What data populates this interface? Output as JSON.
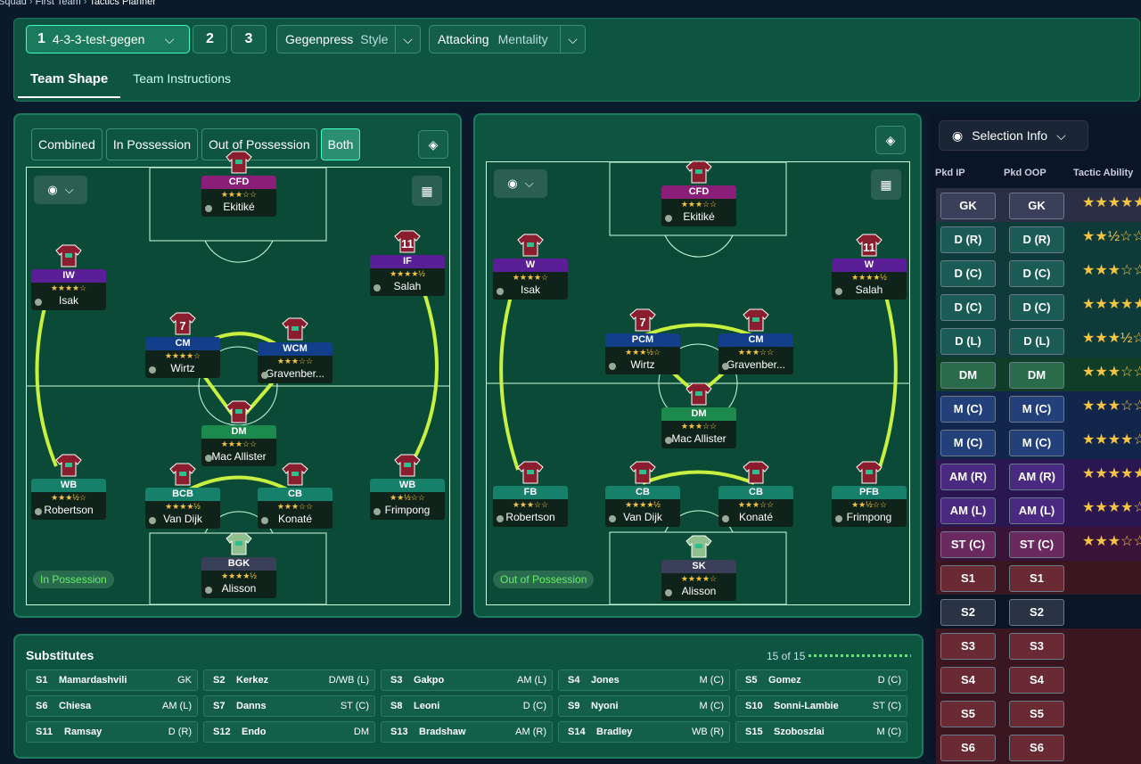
{
  "breadcrumb": {
    "a": "Squad",
    "b": "First Team",
    "c": "Tactics Planner"
  },
  "tactic": {
    "slot": "1",
    "name": "4-3-3-test-gegen",
    "slot2": "2",
    "slot3": "3",
    "style_value": "Gegenpress",
    "style_label": "Style",
    "mentality_value": "Attacking",
    "mentality_label": "Mentality"
  },
  "tabs": [
    "Team Shape",
    "Team Instructions"
  ],
  "phase_buttons": [
    "Combined",
    "In Possession",
    "Out of Possession",
    "Both"
  ],
  "in_possession_label": "In Possession",
  "out_possession_label": "Out of Possession",
  "ip_players": [
    {
      "role": "CFD",
      "name": "Ekitiké",
      "stars": "★★★☆☆",
      "color": "#8a1e78"
    },
    {
      "role": "IW",
      "name": "Isak",
      "stars": "★★★★☆",
      "color": "#5a1f96"
    },
    {
      "role": "IF",
      "name": "Salah",
      "stars": "★★★★½",
      "color": "#5a1f96",
      "num": "11"
    },
    {
      "role": "CM",
      "name": "Wirtz",
      "stars": "★★★★☆",
      "color": "#133f8a",
      "num": "7"
    },
    {
      "role": "WCM",
      "name": "Gravenber...",
      "stars": "★★★☆☆",
      "color": "#133f8a"
    },
    {
      "role": "DM",
      "name": "Mac Allister",
      "stars": "★★★☆☆",
      "color": "#1d8a4d"
    },
    {
      "role": "WB",
      "name": "Robertson",
      "stars": "★★★½☆",
      "color": "#17806a"
    },
    {
      "role": "BCB",
      "name": "Van Dijk",
      "stars": "★★★★½",
      "color": "#17806a"
    },
    {
      "role": "CB",
      "name": "Konaté",
      "stars": "★★★☆☆",
      "color": "#17806a"
    },
    {
      "role": "WB",
      "name": "Frimpong",
      "stars": "★★½☆☆",
      "color": "#17806a"
    },
    {
      "role": "BGK",
      "name": "Alisson",
      "stars": "★★★★½",
      "color": "#3a3f5a"
    }
  ],
  "op_players": [
    {
      "role": "CFD",
      "name": "Ekitiké",
      "stars": "★★★☆☆",
      "color": "#8a1e78"
    },
    {
      "role": "W",
      "name": "Isak",
      "stars": "★★★★☆",
      "color": "#5a1f96"
    },
    {
      "role": "W",
      "name": "Salah",
      "stars": "★★★★½",
      "color": "#5a1f96",
      "num": "11"
    },
    {
      "role": "PCM",
      "name": "Wirtz",
      "stars": "★★★½☆",
      "color": "#133f8a",
      "num": "7"
    },
    {
      "role": "CM",
      "name": "Gravenber...",
      "stars": "★★★☆☆",
      "color": "#133f8a"
    },
    {
      "role": "DM",
      "name": "Mac Allister",
      "stars": "★★★☆☆",
      "color": "#1d8a4d"
    },
    {
      "role": "FB",
      "name": "Robertson",
      "stars": "★★★☆☆",
      "color": "#17806a"
    },
    {
      "role": "CB",
      "name": "Van Dijk",
      "stars": "★★★★½",
      "color": "#17806a"
    },
    {
      "role": "CB",
      "name": "Konaté",
      "stars": "★★★☆☆",
      "color": "#17806a"
    },
    {
      "role": "PFB",
      "name": "Frimpong",
      "stars": "★★½☆☆",
      "color": "#17806a"
    },
    {
      "role": "SK",
      "name": "Alisson",
      "stars": "★★★★☆",
      "color": "#3a3f5a"
    }
  ],
  "substitutes": {
    "title": "Substitutes",
    "count": "15 of 15",
    "items": [
      {
        "n": "S1",
        "name": "Mamardashvili",
        "pos": "GK"
      },
      {
        "n": "S2",
        "name": "Kerkez",
        "pos": "D/WB (L)"
      },
      {
        "n": "S3",
        "name": "Gakpo",
        "pos": "AM (L)"
      },
      {
        "n": "S4",
        "name": "Jones",
        "pos": "M (C)"
      },
      {
        "n": "S5",
        "name": "Gomez",
        "pos": "D (C)"
      },
      {
        "n": "S6",
        "name": "Chiesa",
        "pos": "AM (L)"
      },
      {
        "n": "S7",
        "name": "Danns",
        "pos": "ST (C)"
      },
      {
        "n": "S8",
        "name": "Leoni",
        "pos": "D (C)"
      },
      {
        "n": "S9",
        "name": "Nyoni",
        "pos": "M (C)"
      },
      {
        "n": "S10",
        "name": "Sonni-Lambie",
        "pos": "ST (C)"
      },
      {
        "n": "S11",
        "name": "Ramsay",
        "pos": "D (R)"
      },
      {
        "n": "S12",
        "name": "Endo",
        "pos": "DM"
      },
      {
        "n": "S13",
        "name": "Bradshaw",
        "pos": "AM (R)"
      },
      {
        "n": "S14",
        "name": "Bradley",
        "pos": "WB (R)"
      },
      {
        "n": "S15",
        "name": "Szoboszlai",
        "pos": "M (C)"
      }
    ]
  },
  "selection": {
    "label": "Selection Info",
    "col1": "Pkd IP",
    "col2": "Pkd OOP",
    "col3": "Tactic Ability",
    "rows": [
      {
        "ip": "GK",
        "oop": "GK",
        "stars": "★★★★★",
        "bg": "#2a2f45",
        "tint": "#3a3f5a"
      },
      {
        "ip": "D (R)",
        "oop": "D (R)",
        "stars": "★★½☆☆",
        "bg": "#0e3b3a",
        "tint": "#1a5c55"
      },
      {
        "ip": "D (C)",
        "oop": "D (C)",
        "stars": "★★★☆☆",
        "bg": "#0e3b3a",
        "tint": "#1a5c55"
      },
      {
        "ip": "D (C)",
        "oop": "D (C)",
        "stars": "★★★★★",
        "bg": "#0e3b3a",
        "tint": "#1a5c55"
      },
      {
        "ip": "D (L)",
        "oop": "D (L)",
        "stars": "★★★½☆",
        "bg": "#0e3b3a",
        "tint": "#1a5c55"
      },
      {
        "ip": "DM",
        "oop": "DM",
        "stars": "★★★☆☆",
        "bg": "#0f3d28",
        "tint": "#2a6b4a"
      },
      {
        "ip": "M (C)",
        "oop": "M (C)",
        "stars": "★★★☆☆",
        "bg": "#12254a",
        "tint": "#23407a"
      },
      {
        "ip": "M (C)",
        "oop": "M (C)",
        "stars": "★★★★☆",
        "bg": "#12254a",
        "tint": "#23407a"
      },
      {
        "ip": "AM (R)",
        "oop": "AM (R)",
        "stars": "★★★★★",
        "bg": "#2a1650",
        "tint": "#4a2a80"
      },
      {
        "ip": "AM (L)",
        "oop": "AM (L)",
        "stars": "★★★★☆",
        "bg": "#2a1650",
        "tint": "#4a2a80"
      },
      {
        "ip": "ST (C)",
        "oop": "ST (C)",
        "stars": "★★★☆☆",
        "bg": "#3a1438",
        "tint": "#6a2a60"
      },
      {
        "ip": "S1",
        "oop": "S1",
        "stars": "",
        "bg": "#3a1620",
        "tint": "#6a2a34"
      },
      {
        "ip": "S2",
        "oop": "S2",
        "stars": "",
        "bg": "#0a1626",
        "tint": "#2a3344"
      },
      {
        "ip": "S3",
        "oop": "S3",
        "stars": "",
        "bg": "#3a1620",
        "tint": "#6a2a34"
      },
      {
        "ip": "S4",
        "oop": "S4",
        "stars": "",
        "bg": "#3a1620",
        "tint": "#6a2a34"
      },
      {
        "ip": "S5",
        "oop": "S5",
        "stars": "",
        "bg": "#3a1620",
        "tint": "#6a2a34"
      },
      {
        "ip": "S6",
        "oop": "S6",
        "stars": "",
        "bg": "#3a1620",
        "tint": "#6a2a34"
      }
    ]
  }
}
